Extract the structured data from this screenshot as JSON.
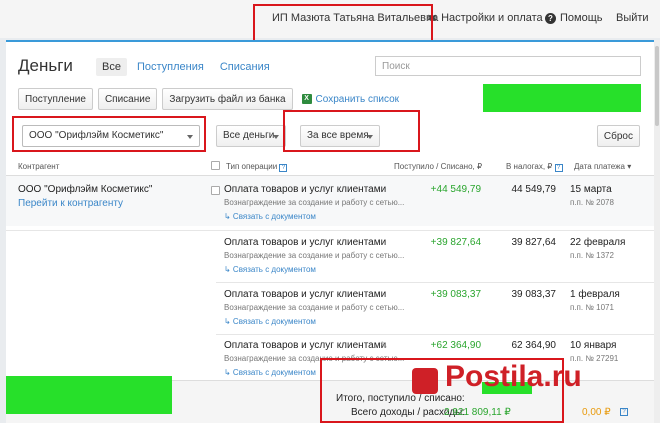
{
  "topbar": {
    "user_name": "ИП Мазюта Татьяна Витальевна",
    "settings_label": "Настройки и оплата",
    "help_label": "Помощь",
    "exit_label": "Выйти"
  },
  "page": {
    "title": "Деньги",
    "tabs": [
      {
        "label": "Все",
        "active": true
      },
      {
        "label": "Поступления",
        "active": false
      },
      {
        "label": "Списания",
        "active": false
      }
    ],
    "search_placeholder": "Поиск"
  },
  "toolbar": {
    "income_button": "Поступление",
    "expense_button": "Списание",
    "upload_button": "Загрузить файл из банка",
    "save_list_link": "Сохранить список"
  },
  "filters": {
    "contractor": "ООО \"Орифлэйм Косметикс\"",
    "money_type": "Все деньги",
    "period": "За все время",
    "reset_label": "Сброс"
  },
  "table": {
    "headers": {
      "contractor": "Контрагент",
      "op_type": "Тип операции",
      "income": "Поступило / Списано, ₽",
      "tax": "В налогах, ₽",
      "date": "Дата платежа"
    },
    "contractor_name": "ООО \"Орифлэйм Косметикс\"",
    "contractor_link": "Перейти к контрагенту",
    "rows": [
      {
        "op": "Оплата товаров и услуг клиентами",
        "desc": "Вознаграждение за создание и работу с сетью...",
        "link": "↳ Связать с документом",
        "income": "+44 549,79",
        "tax": "44 549,79",
        "date": "15 марта",
        "pp": "п.п. № 2078"
      },
      {
        "op": "Оплата товаров и услуг клиентами",
        "desc": "Вознаграждение за создание и работу с сетью...",
        "link": "↳ Связать с документом",
        "income": "+39 827,64",
        "tax": "39 827,64",
        "date": "22 февраля",
        "pp": "п.п. № 1372"
      },
      {
        "op": "Оплата товаров и услуг клиентами",
        "desc": "Вознаграждение за создание и работу с сетью...",
        "link": "↳ Связать с документом",
        "income": "+39 083,37",
        "tax": "39 083,37",
        "date": "1 февраля",
        "pp": "п.п. № 1071"
      },
      {
        "op": "Оплата товаров и услуг клиентами",
        "desc": "Вознаграждение за создание и работу с сетью...",
        "link": "↳ Связать с документом",
        "income": "+62 364,90",
        "tax": "62 364,90",
        "date": "10 января",
        "pp": "п.п. № 27291"
      }
    ]
  },
  "footer": {
    "total_label": "Итого, поступило / списано:",
    "all_label": "Всего доходы / расходы:",
    "all_income": "2 921 809,11 ₽",
    "all_expense": "0,00 ₽"
  },
  "watermark": "Postila.ru",
  "colors": {
    "accent": "#3a86c8",
    "income": "#2aa52e",
    "highlight": "#d9161c",
    "redact": "#27e02a"
  }
}
